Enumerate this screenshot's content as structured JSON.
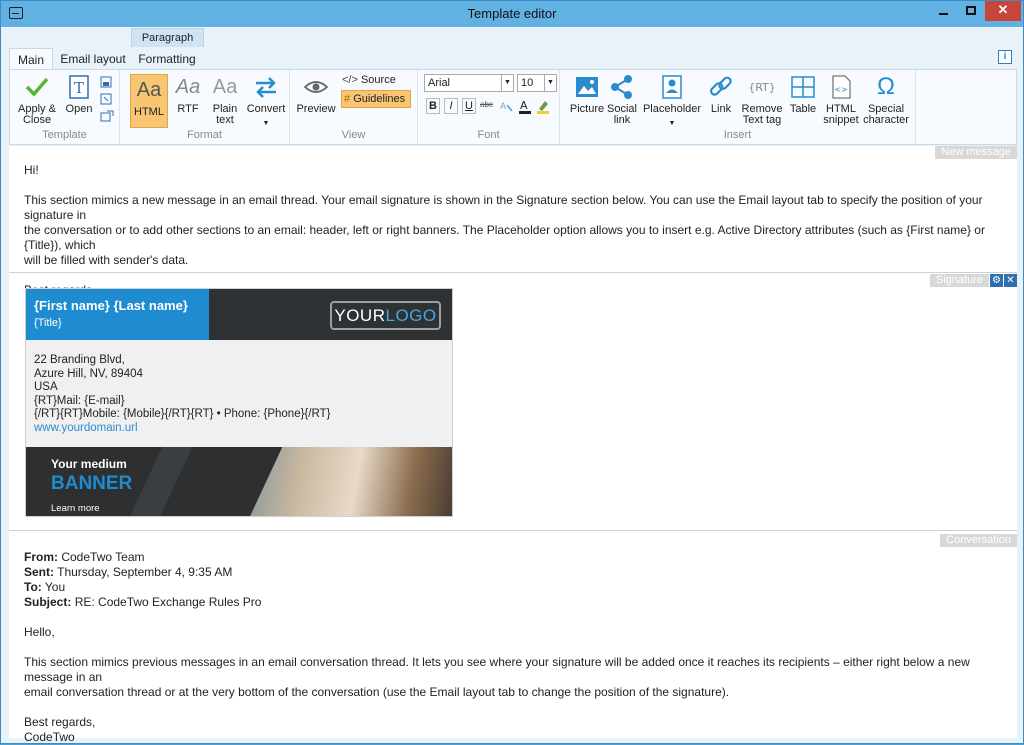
{
  "window": {
    "title": "Template editor"
  },
  "ribbon": {
    "contextual_tab": "Paragraph",
    "tabs": [
      "Main",
      "Email layout",
      "Formatting"
    ],
    "groups": {
      "template": {
        "label": "Template",
        "apply_line1": "Apply &",
        "apply_line2": "Close",
        "open": "Open"
      },
      "format": {
        "label": "Format",
        "html": "HTML",
        "rtf": "RTF",
        "plain_line1": "Plain",
        "plain_line2": "text",
        "convert": "Convert",
        "glyph": "Aa"
      },
      "view": {
        "label": "View",
        "preview": "Preview",
        "source": "Source",
        "guidelines": "Guidelines"
      },
      "font": {
        "label": "Font",
        "family": "Arial",
        "size": "10",
        "bold": "B",
        "italic": "I",
        "underline": "U",
        "strike": "abc"
      },
      "insert": {
        "label": "Insert",
        "picture": "Picture",
        "social_line1": "Social",
        "social_line2": "link",
        "placeholder": "Placeholder",
        "link": "Link",
        "remove_line1": "Remove",
        "remove_line2": "Text tag",
        "table": "Table",
        "html_line1": "HTML",
        "html_line2": "snippet",
        "special_line1": "Special",
        "special_line2": "character"
      }
    }
  },
  "sections": {
    "new_message": {
      "label": "New message",
      "greeting": "Hi!",
      "body_line1": "This section mimics a new message in an email thread. Your email signature is shown in the Signature section below. You can use the Email layout tab to specify the position of your signature in",
      "body_line2": "the conversation or to add other sections to an email: header, left or right banners. The Placeholder option allows you to insert e.g. Active Directory attributes (such as {First name} or {Title}), which",
      "body_line3": "will be filled with sender's data.",
      "closing": "Best regards,"
    },
    "signature": {
      "label": "Signature",
      "name": "{First name} {Last name}",
      "title": "{Title}",
      "logo_a": "YOUR",
      "logo_b": "LOGO",
      "address1": "22 Branding Blvd,",
      "address2": "Azure Hill, NV, 89404",
      "country": "USA",
      "mail": "{RT}Mail: {E-mail}",
      "phones": "{/RT}{RT}Mobile: {Mobile}{/RT}{RT} • Phone: {Phone}{/RT}",
      "url": "www.yourdomain.url",
      "banner_line1": "Your medium",
      "banner_line2": "BANNER",
      "banner_line3": "Learn more"
    },
    "conversation": {
      "label": "Conversation",
      "from_label": "From:",
      "from": "CodeTwo Team",
      "sent_label": "Sent:",
      "sent": "Thursday, September 4, 9:35 AM",
      "to_label": "To:",
      "to": "You",
      "subject_label": "Subject:",
      "subject": "RE: CodeTwo Exchange Rules Pro",
      "greeting": "Hello,",
      "body_line1": "This section mimics previous messages in an email conversation thread. It lets you see where your signature will be added once it reaches its recipients – either right below a new message in an",
      "body_line2": "email conversation thread or at the very bottom of the conversation (use the Email layout tab to change the position of the signature).",
      "closing": "Best regards,",
      "signoff": "CodeTwo"
    }
  }
}
